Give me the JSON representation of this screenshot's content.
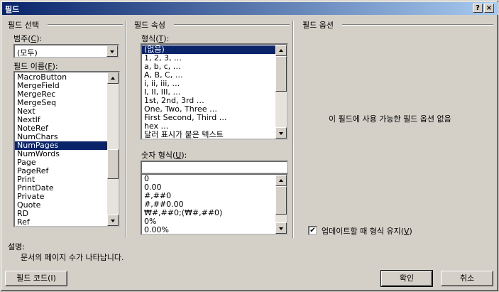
{
  "window": {
    "title": "필드",
    "help_btn": "?",
    "close_btn": "×"
  },
  "sections": {
    "field_select": "필드 선택",
    "field_props": "필드 속성",
    "field_options": "필드 옵션"
  },
  "category": {
    "label_pre": "범주(",
    "label_key": "C",
    "label_post": "):",
    "value": "(모두)"
  },
  "field_names": {
    "label_pre": "필드 이름(",
    "label_key": "F",
    "label_post": "):",
    "items": [
      "MacroButton",
      "MergeField",
      "MergeRec",
      "MergeSeq",
      "Next",
      "NextIf",
      "NoteRef",
      "NumChars",
      "NumPages",
      "NumWords",
      "Page",
      "PageRef",
      "Print",
      "PrintDate",
      "Private",
      "Quote",
      "RD",
      "Ref"
    ],
    "selected": "NumPages"
  },
  "format": {
    "label_pre": "형식(",
    "label_key": "T",
    "label_post": "):",
    "items": [
      "(없음)",
      "1, 2, 3, …",
      "a, b, c, …",
      "A, B, C, …",
      "i, ii, iii, …",
      "I, II, III, …",
      "1st, 2nd, 3rd …",
      "One, Two, Three …",
      "First Second, Third …",
      "hex …",
      "달러 표시가 붙은 텍스트"
    ],
    "selected": "(없음)"
  },
  "number_format": {
    "label_pre": "숫자 형식(",
    "label_key": "U",
    "label_post": "):",
    "value": "",
    "items": [
      "0",
      "0.00",
      "#,##0",
      "#,##0.00",
      "₩#,##0;(₩#,##0)",
      "0%",
      "0.00%"
    ]
  },
  "options": {
    "empty_message": "이 필드에 사용 가능한 필드 옵션 없음"
  },
  "preserve": {
    "label_pre": "업데이트할 때 형식 유지(",
    "label_key": "V",
    "label_post": ")",
    "checked": true
  },
  "description": {
    "label": "설명:",
    "text": "문서의 페이지 수가 나타납니다."
  },
  "buttons": {
    "field_codes": "필드 코드(I)",
    "ok": "확인",
    "cancel": "취소"
  }
}
